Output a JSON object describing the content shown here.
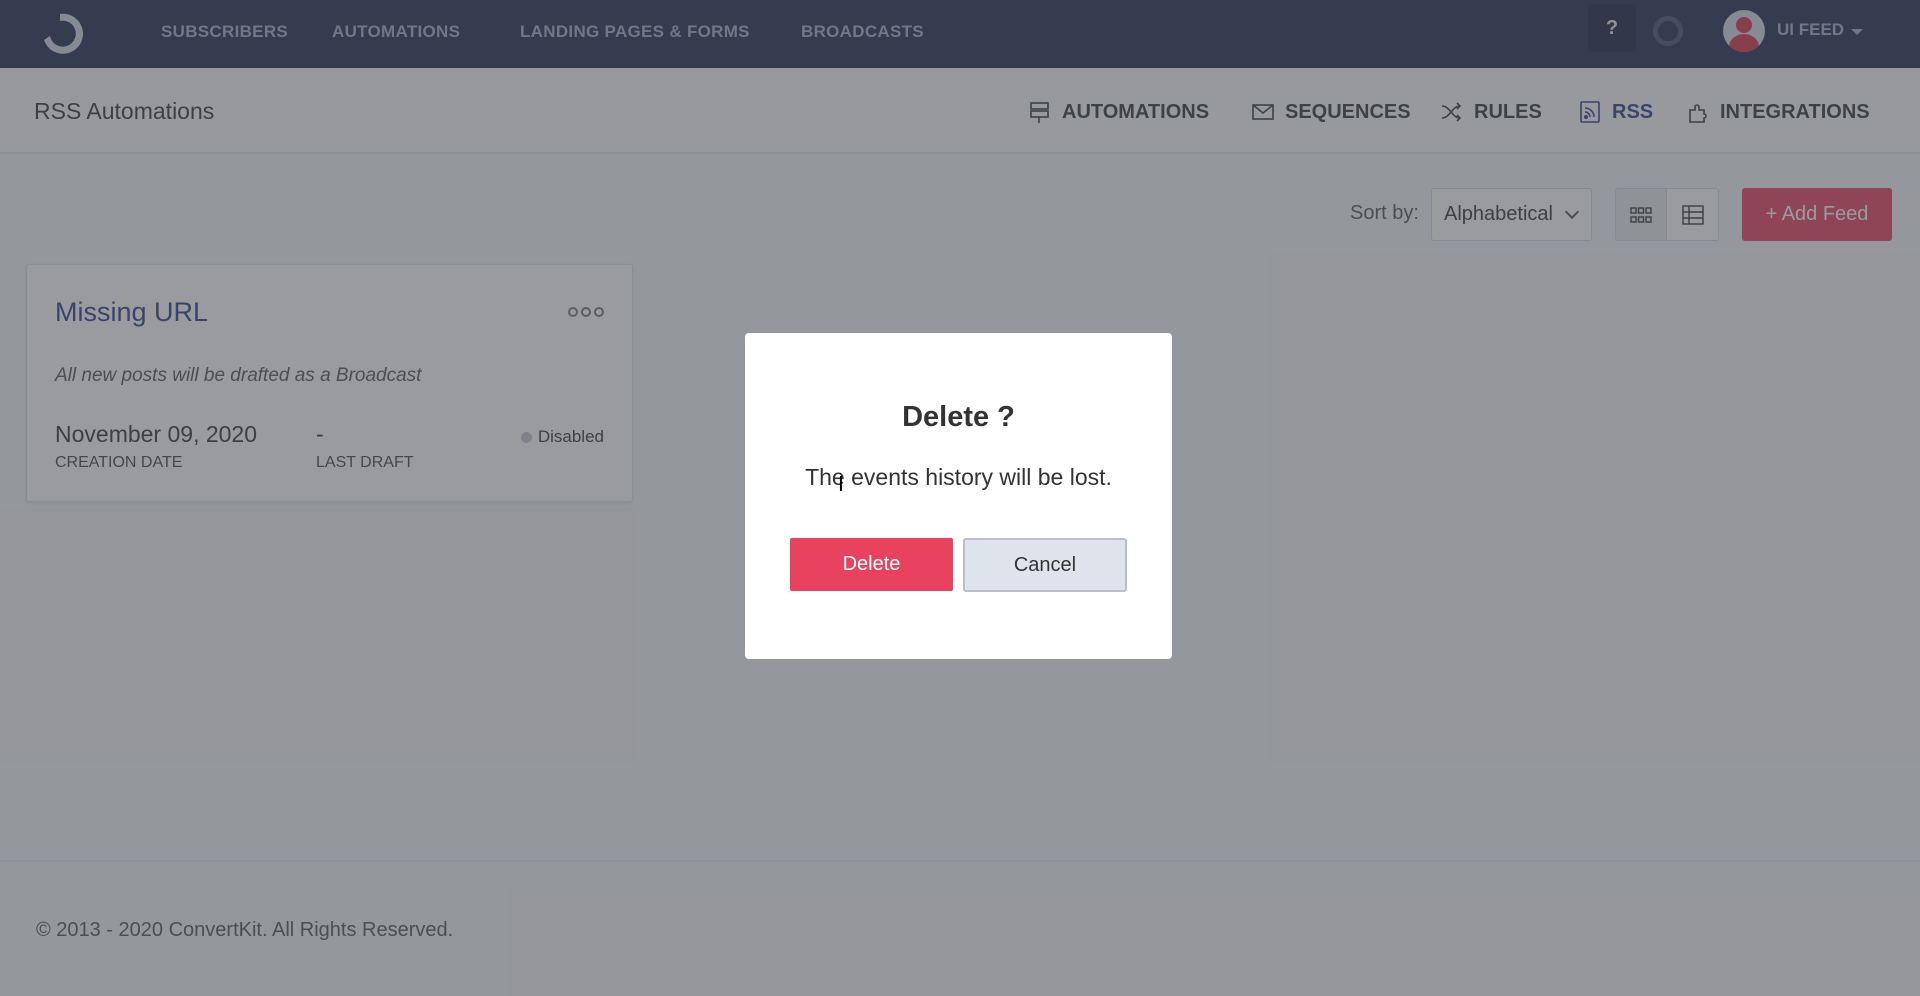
{
  "topnav": {
    "items": [
      {
        "label": "SUBSCRIBERS"
      },
      {
        "label": "AUTOMATIONS"
      },
      {
        "label": "LANDING PAGES & FORMS"
      },
      {
        "label": "BROADCASTS"
      }
    ],
    "help_label": "?",
    "user_name": "UI FEED"
  },
  "subheader": {
    "title": "RSS Automations",
    "tabs": [
      {
        "label": "AUTOMATIONS",
        "icon": "signpost-icon"
      },
      {
        "label": "SEQUENCES",
        "icon": "envelope-icon"
      },
      {
        "label": "RULES",
        "icon": "shuffle-icon"
      },
      {
        "label": "RSS",
        "icon": "rss-icon",
        "active": true
      },
      {
        "label": "INTEGRATIONS",
        "icon": "puzzle-icon"
      }
    ]
  },
  "toolbar": {
    "sort_label": "Sort by:",
    "sort_value": "Alphabetical",
    "add_feed_label": "+ Add Feed"
  },
  "feeds": [
    {
      "title": "Missing URL",
      "description": "All new posts will be drafted as a Broadcast",
      "creation_date": "November 09, 2020",
      "creation_date_label": "CREATION DATE",
      "last_draft": "-",
      "last_draft_label": "LAST DRAFT",
      "status": "Disabled"
    }
  ],
  "footer": {
    "copyright": "© 2013 - 2020 ConvertKit. All Rights Reserved."
  },
  "modal": {
    "title": "Delete ?",
    "message": "The events history will be lost.",
    "delete_label": "Delete",
    "cancel_label": "Cancel"
  },
  "colors": {
    "nav_bg": "#222d52",
    "accent_red": "#e8425f",
    "active_blue": "#2c3e8f"
  }
}
